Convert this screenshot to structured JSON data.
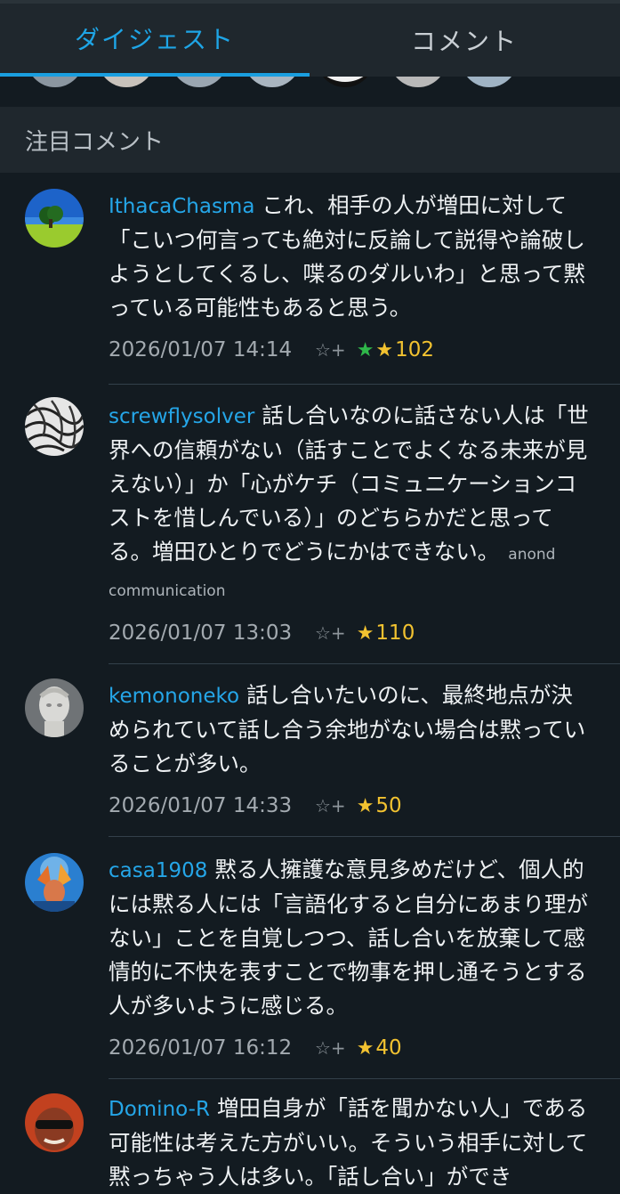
{
  "tabs": {
    "digest": "ダイジェスト",
    "comment": "コメント"
  },
  "section_title": "注目コメント",
  "comments": [
    {
      "user": "IthacaChasma",
      "text": "これ、相手の人が増田に対して「こいつ何言っても絶対に反論して説得や論破しようとしてくるし、喋るのダルいわ」と思って黙っている可能性もあると思う。",
      "tags": "",
      "date": "2026/01/07 14:14",
      "add_star": "☆+",
      "green_stars": "★",
      "yellow_star": "★",
      "count": "102"
    },
    {
      "user": "screwflysolver",
      "text": "話し合いなのに話さない人は「世界への信頼がない（話すことでよくなる未来が見えない）」か「心がケチ（コミュニケーションコストを惜しんでいる）」のどちらかだと思ってる。増田ひとりでどうにかはできない。",
      "tags": "anond communication",
      "date": "2026/01/07 13:03",
      "add_star": "☆+",
      "green_stars": "",
      "yellow_star": "★",
      "count": "110"
    },
    {
      "user": "kemononeko",
      "text": "話し合いたいのに、最終地点が決められていて話し合う余地がない場合は黙っていることが多い。",
      "tags": "",
      "date": "2026/01/07 14:33",
      "add_star": "☆+",
      "green_stars": "",
      "yellow_star": "★",
      "count": "50"
    },
    {
      "user": "casa1908",
      "text": "黙る人擁護な意見多めだけど、個人的には黙る人には「言語化すると自分にあまり理がない」ことを自覚しつつ、話し合いを放棄して感情的に不快を表すことで物事を押し通そうとする人が多いように感じる。",
      "tags": "",
      "date": "2026/01/07 16:12",
      "add_star": "☆+",
      "green_stars": "",
      "yellow_star": "★",
      "count": "40"
    },
    {
      "user": "Domino-R",
      "text": "増田自身が「話を聞かない人」である可能性は考えた方がいい。そういう相手に対して黙っちゃう人は多い。「話し合い」ができ",
      "tags": "",
      "date": "",
      "add_star": "",
      "green_stars": "",
      "yellow_star": "",
      "count": ""
    }
  ]
}
